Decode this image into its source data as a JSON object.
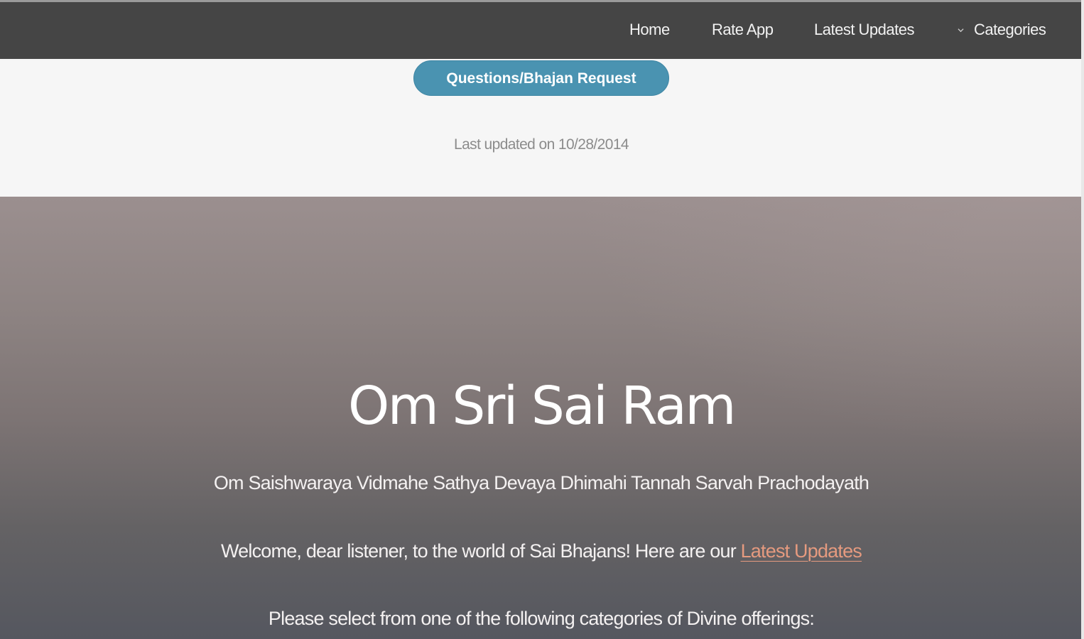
{
  "nav": {
    "items": [
      {
        "label": "Home"
      },
      {
        "label": "Rate App"
      },
      {
        "label": "Latest Updates"
      },
      {
        "label": "Categories",
        "icon": "chevron-down-icon"
      }
    ]
  },
  "top": {
    "request_button": "Questions/Bhajan Request",
    "last_updated": "Last updated on 10/28/2014"
  },
  "hero": {
    "title": "Om Sri Sai Ram",
    "mantra": "Om Saishwaraya Vidmahe Sathya Devaya Dhimahi Tannah Sarvah Prachodayath",
    "welcome_text": "Welcome, dear listener, to the world of Sai Bhajans! Here are our",
    "welcome_link": "Latest Updates",
    "select_text": "Please select from one of the following categories of Divine offerings:"
  },
  "colors": {
    "navbar_bg": "#454545",
    "button_bg": "#4a93b1",
    "link": "#e59a7f"
  }
}
